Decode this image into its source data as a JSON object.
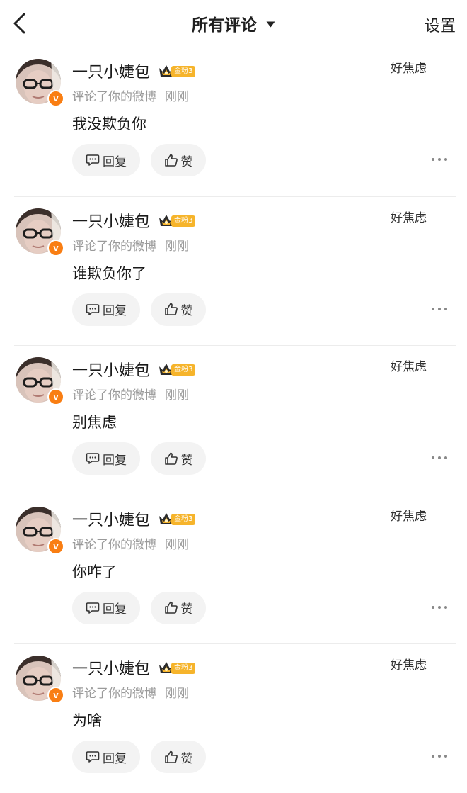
{
  "header": {
    "back_icon": "chevron-left-icon",
    "title": "所有评论",
    "caret_icon": "caret-down-icon",
    "settings_label": "设置"
  },
  "colors": {
    "verified_badge": "#f97e13",
    "fan_badge": "#f6b42b",
    "secondary_text": "#9a9a9a",
    "pill_background": "#f3f3f3"
  },
  "comments": [
    {
      "username": "一只小婕包",
      "verified_icon": "verified-v-icon",
      "fan_badge_icon": "crown-icon",
      "fan_badge_label": "金粉3",
      "action_text": "评论了你的微博",
      "time": "刚刚",
      "text": "我没欺负你",
      "post_ref": "好焦虑",
      "reply_label": "回复",
      "like_label": "赞"
    },
    {
      "username": "一只小婕包",
      "verified_icon": "verified-v-icon",
      "fan_badge_icon": "crown-icon",
      "fan_badge_label": "金粉3",
      "action_text": "评论了你的微博",
      "time": "刚刚",
      "text": "谁欺负你了",
      "post_ref": "好焦虑",
      "reply_label": "回复",
      "like_label": "赞"
    },
    {
      "username": "一只小婕包",
      "verified_icon": "verified-v-icon",
      "fan_badge_icon": "crown-icon",
      "fan_badge_label": "金粉3",
      "action_text": "评论了你的微博",
      "time": "刚刚",
      "text": "别焦虑",
      "post_ref": "好焦虑",
      "reply_label": "回复",
      "like_label": "赞"
    },
    {
      "username": "一只小婕包",
      "verified_icon": "verified-v-icon",
      "fan_badge_icon": "crown-icon",
      "fan_badge_label": "金粉3",
      "action_text": "评论了你的微博",
      "time": "刚刚",
      "text": "你咋了",
      "post_ref": "好焦虑",
      "reply_label": "回复",
      "like_label": "赞"
    },
    {
      "username": "一只小婕包",
      "verified_icon": "verified-v-icon",
      "fan_badge_icon": "crown-icon",
      "fan_badge_label": "金粉3",
      "action_text": "评论了你的微博",
      "time": "刚刚",
      "text": "为啥",
      "post_ref": "好焦虑",
      "reply_label": "回复",
      "like_label": "赞"
    }
  ]
}
